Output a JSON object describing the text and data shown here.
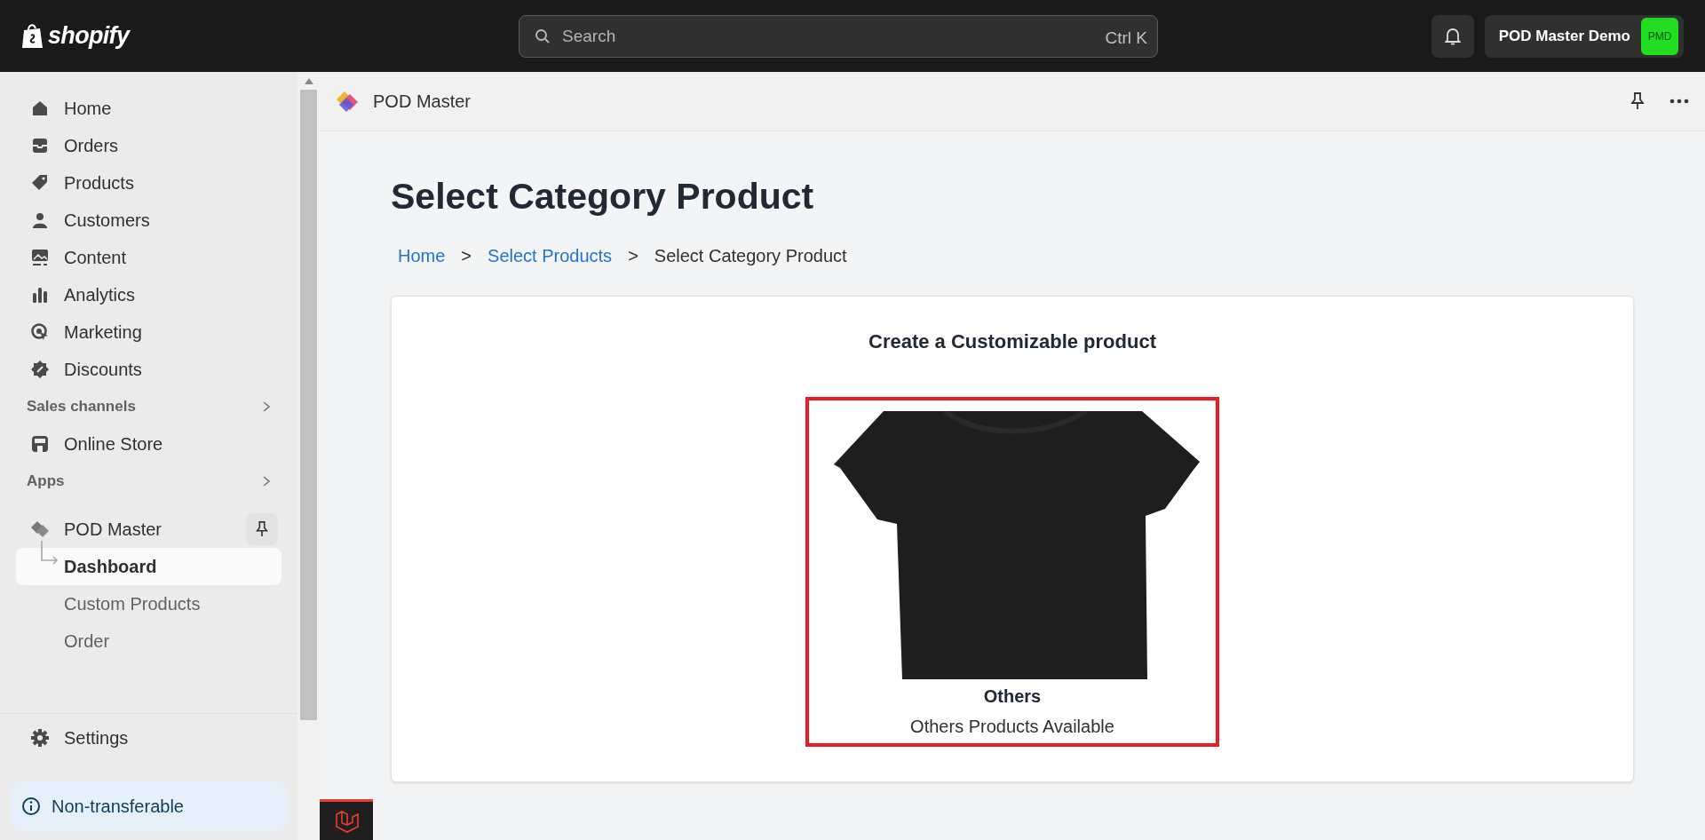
{
  "topbar": {
    "logo": "shopify",
    "search": {
      "placeholder": "Search",
      "shortcut": "Ctrl K"
    },
    "store": {
      "name": "POD Master Demo",
      "initials": "PMD",
      "color": "#22dd22"
    }
  },
  "sidebar": {
    "items": [
      {
        "kind": "home",
        "label": "Home",
        "selected": false
      },
      {
        "kind": "orders",
        "label": "Orders",
        "selected": false
      },
      {
        "kind": "products",
        "label": "Products",
        "selected": false
      },
      {
        "kind": "customers",
        "label": "Customers",
        "selected": false
      },
      {
        "kind": "content",
        "label": "Content",
        "selected": false
      },
      {
        "kind": "analytics",
        "label": "Analytics",
        "selected": false
      },
      {
        "kind": "marketing",
        "label": "Marketing",
        "selected": false
      },
      {
        "kind": "discounts",
        "label": "Discounts",
        "selected": false
      }
    ],
    "sales_channels": {
      "heading": "Sales channels",
      "items": [
        {
          "kind": "store",
          "label": "Online Store",
          "selected": false
        }
      ]
    },
    "apps": {
      "heading": "Apps",
      "app": {
        "label": "POD Master",
        "children": [
          {
            "label": "Dashboard",
            "selected": true
          },
          {
            "label": "Custom Products",
            "selected": false
          },
          {
            "label": "Order",
            "selected": false
          }
        ]
      }
    },
    "settings": "Settings",
    "notice": "Non-transferable"
  },
  "app_header": {
    "title": "POD Master"
  },
  "page": {
    "title": "Select Category Product",
    "breadcrumb": [
      {
        "label": "Home",
        "link": true
      },
      {
        "label": ">",
        "link": false
      },
      {
        "label": "Select Products",
        "link": true
      },
      {
        "label": ">",
        "link": false
      },
      {
        "label": "Select Category Product",
        "link": false
      }
    ],
    "card": {
      "heading": "Create a Customizable product",
      "categories": [
        {
          "name": "Others",
          "description": "Others Products Available",
          "highlighted": true
        }
      ]
    }
  }
}
